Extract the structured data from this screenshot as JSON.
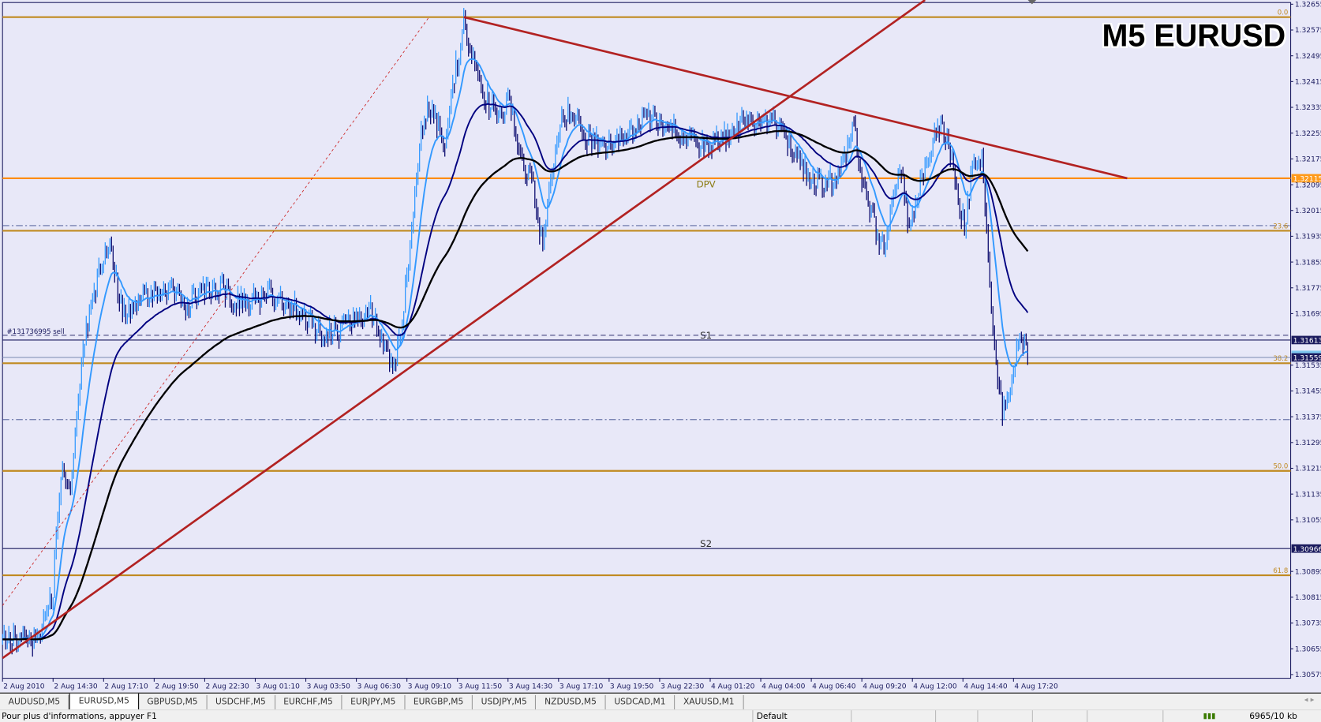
{
  "window": {
    "title": "M5 EURUSD"
  },
  "chart_data": {
    "type": "candlestick-bar",
    "symbol": "EURUSD",
    "timeframe": "M5",
    "title": "M5 EURUSD",
    "ylim": [
      1.30575,
      1.32655
    ],
    "y_ticks": [
      "1.32655",
      "1.32575",
      "1.32495",
      "1.32415",
      "1.32335",
      "1.32255",
      "1.32175",
      "1.32095",
      "1.32015",
      "1.31935",
      "1.31855",
      "1.31775",
      "1.31695",
      "1.31535",
      "1.31455",
      "1.31375",
      "1.31295",
      "1.31215",
      "1.31135",
      "1.31055",
      "1.30895",
      "1.30815",
      "1.30735",
      "1.30655",
      "1.30575"
    ],
    "x_ticks": [
      "2 Aug 2010",
      "2 Aug 14:30",
      "2 Aug 17:10",
      "2 Aug 19:50",
      "2 Aug 22:30",
      "3 Aug 01:10",
      "3 Aug 03:50",
      "3 Aug 06:30",
      "3 Aug 09:10",
      "3 Aug 11:50",
      "3 Aug 14:30",
      "3 Aug 17:10",
      "3 Aug 19:50",
      "3 Aug 22:30",
      "4 Aug 01:20",
      "4 Aug 04:00",
      "4 Aug 06:40",
      "4 Aug 09:20",
      "4 Aug 12:00",
      "4 Aug 14:40",
      "4 Aug 17:20"
    ],
    "grid": false,
    "price_path": [
      [
        "2 11:50",
        1.30681
      ],
      [
        "2 12:45",
        1.30694
      ],
      [
        "2 13:35",
        1.30668
      ],
      [
        "2 14:30",
        1.30838
      ],
      [
        "2 14:55",
        1.31204
      ],
      [
        "2 15:25",
        1.31178
      ],
      [
        "2 15:50",
        1.31413
      ],
      [
        "2 16:10",
        1.31622
      ],
      [
        "2 16:35",
        1.31727
      ],
      [
        "2 17:00",
        1.31858
      ],
      [
        "2 17:30",
        1.3191
      ],
      [
        "2 18:10",
        1.31701
      ],
      [
        "2 18:50",
        1.31727
      ],
      [
        "2 19:40",
        1.31753
      ],
      [
        "2 20:35",
        1.31766
      ],
      [
        "2 21:30",
        1.31727
      ],
      [
        "2 22:20",
        1.31766
      ],
      [
        "2 23:15",
        1.31779
      ],
      [
        "3 00:10",
        1.31727
      ],
      [
        "3 01:00",
        1.3174
      ],
      [
        "3 01:55",
        1.31753
      ],
      [
        "3 02:50",
        1.31727
      ],
      [
        "3 03:40",
        1.31701
      ],
      [
        "3 04:35",
        1.31636
      ],
      [
        "3 05:30",
        1.31636
      ],
      [
        "3 06:20",
        1.31675
      ],
      [
        "3 07:15",
        1.31701
      ],
      [
        "3 08:10",
        1.3157
      ],
      [
        "3 08:35",
        1.31544
      ],
      [
        "3 09:00",
        1.31727
      ],
      [
        "3 09:30",
        1.32015
      ],
      [
        "3 09:55",
        1.32276
      ],
      [
        "3 10:20",
        1.32328
      ],
      [
        "3 10:50",
        1.32276
      ],
      [
        "3 11:15",
        1.32224
      ],
      [
        "3 11:40",
        1.32433
      ],
      [
        "3 12:10",
        1.3259
      ],
      [
        "3 12:35",
        1.32485
      ],
      [
        "3 13:15",
        1.3238
      ],
      [
        "3 13:55",
        1.32302
      ],
      [
        "3 14:35",
        1.32354
      ],
      [
        "3 15:15",
        1.32171
      ],
      [
        "3 15:55",
        1.32067
      ],
      [
        "3 16:20",
        1.31884
      ],
      [
        "3 16:50",
        1.32145
      ],
      [
        "3 17:15",
        1.32302
      ],
      [
        "3 17:55",
        1.32328
      ],
      [
        "3 18:50",
        1.32224
      ],
      [
        "3 19:40",
        1.32224
      ],
      [
        "3 20:35",
        1.32237
      ],
      [
        "3 21:30",
        1.32302
      ],
      [
        "3 22:20",
        1.32302
      ],
      [
        "3 23:15",
        1.32276
      ],
      [
        "4 00:10",
        1.32237
      ],
      [
        "4 01:00",
        1.32224
      ],
      [
        "4 01:55",
        1.32237
      ],
      [
        "4 02:50",
        1.32289
      ],
      [
        "4 03:40",
        1.32302
      ],
      [
        "4 04:35",
        1.32289
      ],
      [
        "4 05:30",
        1.32211
      ],
      [
        "4 06:20",
        1.32119
      ],
      [
        "4 07:15",
        1.32093
      ],
      [
        "4 08:10",
        1.32145
      ],
      [
        "4 08:40",
        1.32302
      ],
      [
        "4 09:15",
        1.32093
      ],
      [
        "4 09:55",
        1.31962
      ],
      [
        "4 10:20",
        1.31884
      ],
      [
        "4 10:50",
        1.32067
      ],
      [
        "4 11:15",
        1.32145
      ],
      [
        "4 11:40",
        1.31962
      ],
      [
        "4 12:10",
        1.32093
      ],
      [
        "4 12:35",
        1.32171
      ],
      [
        "4 13:15",
        1.32276
      ],
      [
        "4 13:40",
        1.3225
      ],
      [
        "4 14:10",
        1.32067
      ],
      [
        "4 14:35",
        1.31962
      ],
      [
        "4 15:00",
        1.32145
      ],
      [
        "4 15:30",
        1.32198
      ],
      [
        "4 15:55",
        1.31753
      ],
      [
        "4 16:15",
        1.31544
      ],
      [
        "4 16:35",
        1.31387
      ],
      [
        "4 17:00",
        1.31466
      ],
      [
        "4 17:30",
        1.31622
      ],
      [
        "4 17:40",
        1.31596
      ],
      [
        "4 18:00",
        1.31557
      ]
    ],
    "moving_averages": [
      {
        "color": "#3399ff"
      },
      {
        "color": "#000080"
      },
      {
        "color": "#000000"
      }
    ],
    "fibonacci": [
      {
        "level": "0.0",
        "price": 1.32615
      },
      {
        "level": "23.6",
        "price": 1.31952
      },
      {
        "level": "38.2",
        "price": 1.31541
      },
      {
        "level": "50.0",
        "price": 1.31207
      },
      {
        "level": "61.8",
        "price": 1.30883
      }
    ],
    "levels": [
      {
        "label": "DPV",
        "price": 1.32115,
        "color": "#ff8c00",
        "badge": "1.32115"
      },
      {
        "label": "S1",
        "price": 1.31613,
        "color": "#1a1a5e",
        "badge": "1.31613"
      },
      {
        "label": "S2",
        "price": 1.30966,
        "color": "#1a1a5e",
        "badge": "1.30966"
      }
    ],
    "bid": {
      "price": 1.31559,
      "badge": "1.31559"
    },
    "order": {
      "label": "#131736995 sell",
      "price": 1.31625
    },
    "dashdot_levels": [
      1.31968,
      1.31366
    ],
    "trendlines": [
      {
        "from": [
          "3 12:10",
          1.32615
        ],
        "to": [
          "4 23:10",
          1.32115
        ],
        "color": "#b22222"
      },
      {
        "from": [
          "2 11:50",
          1.30626
        ],
        "to": [
          "4 12:30",
          1.32668
        ],
        "color": "#b22222"
      },
      {
        "from": [
          "2 11:50",
          1.30789
        ],
        "to": [
          "3 10:20",
          1.32615
        ],
        "color": "#cc2222",
        "dashed": true
      }
    ],
    "colors": {
      "background": "#e8e8f8",
      "fib": "#c08a20",
      "bar_up": "#3399ff",
      "bar_down": "#0a0a6e"
    }
  },
  "tabs": [
    "AUDUSD,M5",
    "EURUSD,M5",
    "GBPUSD,M5",
    "USDCHF,M5",
    "EURCHF,M5",
    "EURJPY,M5",
    "EURGBP,M5",
    "USDJPY,M5",
    "NZDUSD,M5",
    "USDCAD,M1",
    "XAUUSD,M1"
  ],
  "active_tab": "EURUSD,M5",
  "status": {
    "help": "Pour plus d'informations, appuyer F1",
    "profile": "Default",
    "traffic": "6965/10 kb"
  }
}
